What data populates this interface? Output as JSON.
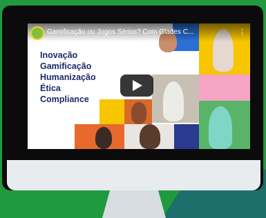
{
  "video": {
    "title": "Gamificação ou Jogos Sérios? Com Glades C...",
    "menu_icon": "⋮",
    "keywords": [
      "Inovação",
      "Gamificação",
      "Humanização",
      "Ética",
      "Compliance"
    ],
    "play_icon": "play-icon"
  },
  "colors": {
    "background": "#1f9a3f",
    "keyword_text": "#1b2a6b",
    "accent_yellow": "#f7c600",
    "accent_orange": "#e8692e",
    "accent_pink": "#f6a4c3",
    "accent_blue": "#2a6fd6"
  }
}
